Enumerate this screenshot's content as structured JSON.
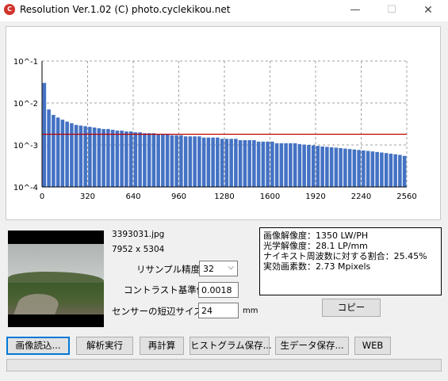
{
  "window": {
    "title": "Resolution Ver.1.02 (C) photo.cyclekikou.net",
    "app_icon": "C",
    "buttons": {
      "minimize": "—",
      "maximize": "☐",
      "close": "✕"
    }
  },
  "chart_data": {
    "type": "bar",
    "xlabel": "",
    "ylabel": "",
    "yscale": "log",
    "ylim": [
      0.0001,
      0.1
    ],
    "xlim": [
      0,
      2560
    ],
    "y_tick_labels": [
      "10^-1",
      "10^-2",
      "10^-3",
      "10^-4"
    ],
    "y_tick_values": [
      0.1,
      0.01,
      0.001,
      0.0001
    ],
    "x_tick_labels": [
      "0",
      "320",
      "640",
      "960",
      "1280",
      "1600",
      "1920",
      "2240",
      "2560"
    ],
    "x_tick_values": [
      0,
      320,
      640,
      960,
      1280,
      1600,
      1920,
      2240,
      2560
    ],
    "bar_color": "#4472c4",
    "threshold_line": {
      "value": 0.0018,
      "color": "#c00000"
    },
    "grid": "dashed",
    "bins": [
      [
        0,
        0.03
      ],
      [
        32,
        0.007
      ],
      [
        64,
        0.0052
      ],
      [
        96,
        0.0045
      ],
      [
        128,
        0.004
      ],
      [
        160,
        0.0036
      ],
      [
        192,
        0.0033
      ],
      [
        224,
        0.003
      ],
      [
        256,
        0.0029
      ],
      [
        288,
        0.0028
      ],
      [
        320,
        0.0027
      ],
      [
        352,
        0.0026
      ],
      [
        384,
        0.0025
      ],
      [
        416,
        0.0024
      ],
      [
        448,
        0.0024
      ],
      [
        480,
        0.0023
      ],
      [
        512,
        0.0022
      ],
      [
        544,
        0.0022
      ],
      [
        576,
        0.0021
      ],
      [
        608,
        0.0021
      ],
      [
        640,
        0.002
      ],
      [
        672,
        0.002
      ],
      [
        704,
        0.0019
      ],
      [
        736,
        0.0019
      ],
      [
        768,
        0.0019
      ],
      [
        800,
        0.0018
      ],
      [
        832,
        0.0018
      ],
      [
        864,
        0.0018
      ],
      [
        896,
        0.0017
      ],
      [
        928,
        0.0017
      ],
      [
        960,
        0.0017
      ],
      [
        992,
        0.0016
      ],
      [
        1024,
        0.0016
      ],
      [
        1056,
        0.0016
      ],
      [
        1088,
        0.0016
      ],
      [
        1120,
        0.0015
      ],
      [
        1152,
        0.0015
      ],
      [
        1184,
        0.0015
      ],
      [
        1216,
        0.0015
      ],
      [
        1248,
        0.0014
      ],
      [
        1280,
        0.0014
      ],
      [
        1312,
        0.0014
      ],
      [
        1344,
        0.0014
      ],
      [
        1376,
        0.0013
      ],
      [
        1408,
        0.0013
      ],
      [
        1440,
        0.0013
      ],
      [
        1472,
        0.0013
      ],
      [
        1504,
        0.0012
      ],
      [
        1536,
        0.0012
      ],
      [
        1568,
        0.0012
      ],
      [
        1600,
        0.0012
      ],
      [
        1632,
        0.0011
      ],
      [
        1664,
        0.0011
      ],
      [
        1696,
        0.0011
      ],
      [
        1728,
        0.0011
      ],
      [
        1760,
        0.0011
      ],
      [
        1792,
        0.00105
      ],
      [
        1824,
        0.00102
      ],
      [
        1856,
        0.001
      ],
      [
        1888,
        0.00098
      ],
      [
        1920,
        0.00095
      ],
      [
        1952,
        0.00092
      ],
      [
        1984,
        0.0009
      ],
      [
        2016,
        0.00088
      ],
      [
        2048,
        0.00086
      ],
      [
        2080,
        0.00084
      ],
      [
        2112,
        0.00082
      ],
      [
        2144,
        0.0008
      ],
      [
        2176,
        0.00078
      ],
      [
        2208,
        0.00076
      ],
      [
        2240,
        0.00074
      ],
      [
        2272,
        0.00072
      ],
      [
        2304,
        0.0007
      ],
      [
        2336,
        0.00068
      ],
      [
        2368,
        0.00066
      ],
      [
        2400,
        0.00064
      ],
      [
        2432,
        0.00062
      ],
      [
        2464,
        0.0006
      ],
      [
        2496,
        0.00058
      ],
      [
        2528,
        0.00055
      ]
    ]
  },
  "image": {
    "file_name": "3393031.jpg",
    "size": "7952 x 5304"
  },
  "settings": {
    "resample_label": "リサンプル精度",
    "resample_value": "32",
    "contrast_label": "コントラスト基準値",
    "contrast_value": "0.0018",
    "sensor_label": "センサーの短辺サイズ",
    "sensor_value": "24",
    "sensor_unit": "mm"
  },
  "results": {
    "line1": "画像解像度：1350 LW/PH",
    "line2": "光学解像度：28.1 LP/mm",
    "line3": "ナイキスト周波数に対する割合：25.45%",
    "line4": "実効画素数：2.73 Mpixels"
  },
  "buttons": {
    "copy": "コピー",
    "load_image": "画像読込...",
    "analyze": "解析実行",
    "recalc": "再計算",
    "save_histogram": "ヒストグラム保存...",
    "save_raw": "生データ保存...",
    "web": "WEB"
  },
  "progress": {
    "value": 0,
    "color": "#06b025"
  }
}
